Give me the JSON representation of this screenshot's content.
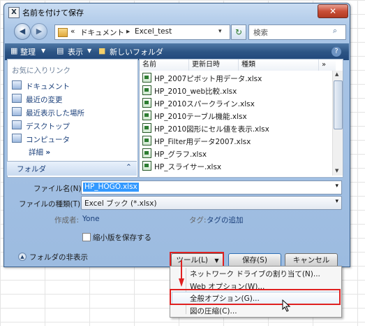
{
  "window": {
    "title": "名前を付けて保存",
    "close_glyph": "✕"
  },
  "nav": {
    "breadcrumb_root": "«",
    "breadcrumb": [
      "ドキュメント",
      "Excel_test"
    ],
    "search_placeholder": "検索"
  },
  "toolbar": {
    "organize": "整理",
    "views": "表示",
    "new_folder": "新しいフォルダ",
    "help": "?"
  },
  "sidebar": {
    "header": "お気に入りリンク",
    "items": [
      {
        "label": "ドキュメント",
        "icon": "documents-icon"
      },
      {
        "label": "最近の変更",
        "icon": "recent-changes-icon"
      },
      {
        "label": "最近表示した場所",
        "icon": "recent-places-icon"
      },
      {
        "label": "デスクトップ",
        "icon": "desktop-icon"
      },
      {
        "label": "コンピュータ",
        "icon": "computer-icon"
      }
    ],
    "more": "詳細",
    "more_glyph": "»",
    "folders": "フォルダ"
  },
  "file_list": {
    "columns": [
      "名前",
      "更新日時",
      "種類"
    ],
    "more_columns": "»",
    "files": [
      "HP_2007ピボット用データ.xlsx",
      "HP_2010_web比較.xlsx",
      "HP_2010スパークライン.xlsx",
      "HP_2010テーブル機能.xlsx",
      "HP_2010図形にセル値を表示.xlsx",
      "HP_Filter用データ2007.xlsx",
      "HP_グラフ.xlsx",
      "HP_スライサー.xlsx"
    ]
  },
  "form": {
    "filename_label": "ファイル名(N):",
    "filename_value": "HP_HOGO.xlsx",
    "filetype_label": "ファイルの種類(T):",
    "filetype_value": "Excel ブック (*.xlsx)",
    "author_label": "作成者:",
    "author_value": "Yone",
    "tags_label": "タグ:",
    "tags_value": "タグの追加",
    "thumbnail_label": "縮小版を保存する"
  },
  "footer": {
    "hide_folders": "フォルダの非表示",
    "tools": "ツール(L)",
    "save": "保存(S)",
    "cancel": "キャンセル"
  },
  "tools_menu": {
    "items": [
      "ネットワーク ドライブの割り当て(N)...",
      "Web オプション(W)...",
      "全般オプション(G)...",
      "図の圧縮(C)..."
    ]
  },
  "colors": {
    "accent": "#e02020",
    "selection": "#3399ff"
  }
}
